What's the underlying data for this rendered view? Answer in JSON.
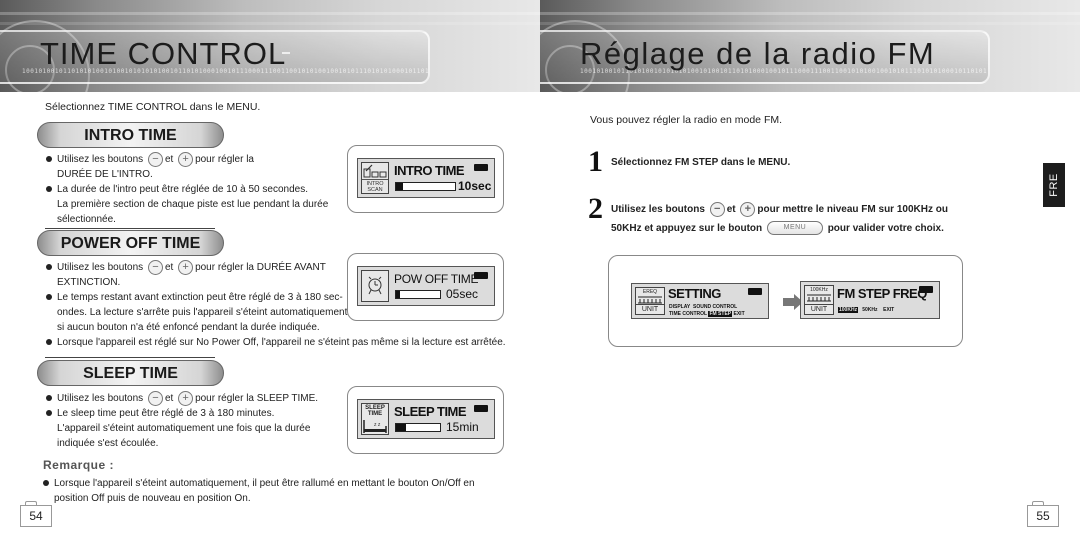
{
  "left_page": {
    "header_title": "TIME CONTROL",
    "binary_decoration": "100101001011010101001010010101010100101101010001001011100011100110010101001001010111010101000101101",
    "intro": "Sélectionnez TIME CONTROL dans le MENU.",
    "sections": [
      {
        "heading": "INTRO TIME",
        "bullets": [
          {
            "pre": "Utilisez les boutons",
            "mid": "et",
            "post": "pour régler la",
            "cont": "DURÉE DE L'INTRO."
          },
          {
            "text": "La durée de l'intro peut être réglée de 10 à 50 secondes.",
            "cont": "La première section de chaque piste est lue pendant la durée",
            "cont2": "sélectionnée."
          }
        ],
        "display": {
          "icon": "intro-scan-icon",
          "icon_label_1": "INTRO",
          "icon_label_2": "SCAN",
          "title": "INTRO TIME",
          "value": "10sec",
          "progress": 0.12
        }
      },
      {
        "heading": "POWER OFF TIME",
        "bullets": [
          {
            "pre": "Utilisez les boutons",
            "mid": "et",
            "post": "pour régler la DURÉE AVANT",
            "cont": "EXTINCTION."
          },
          {
            "text": "Le temps restant avant extinction peut être réglé de 3 à 180 sec-",
            "cont": "ondes. La lecture s'arrête puis l'appareil s'éteint automatiquement",
            "cont2": "si aucun bouton n'a été enfoncé pendant la durée indiquée."
          },
          {
            "text": "Lorsque l'appareil est réglé sur No Power Off, l'appareil ne s'éteint pas même si la lecture est arrêtée."
          }
        ],
        "display": {
          "icon": "alarm-clock-icon",
          "title": "POW OFF TIME",
          "value": "05sec",
          "progress": 0.1
        }
      },
      {
        "heading": "SLEEP TIME",
        "bullets": [
          {
            "pre": "Utilisez les boutons",
            "mid": "et",
            "post": "pour régler la SLEEP TIME."
          },
          {
            "text": "Le sleep time peut être réglé de 3 à 180 minutes.",
            "cont": "L'appareil s'éteint automatiquement une fois que la durée",
            "cont2": "indiquée s'est écoulée."
          }
        ],
        "display": {
          "icon": "sleep-time-icon",
          "icon_label_1": "SLEEP",
          "icon_label_2": "TIME",
          "title": "SLEEP TIME",
          "value": "15min",
          "progress": 0.22
        }
      }
    ],
    "remark_label": "Remarque :",
    "remark_text_1": "Lorsque l'appareil s'éteint automatiquement, il peut être rallumé en mettant le bouton On/Off en",
    "remark_text_2": "position Off puis de nouveau en position On.",
    "page_number": "54"
  },
  "right_page": {
    "header_title": "Réglage de la radio FM",
    "binary_decoration": "100101001011010100101010101001010010110101000100101110001110011001010100100101011101010100010110101",
    "intro": "Vous pouvez régler la radio en mode FM.",
    "steps": [
      {
        "number": "1",
        "text": "Sélectionnez FM STEP dans le MENU."
      },
      {
        "number": "2",
        "pre": "Utilisez les boutons",
        "mid": "et",
        "post": "pour mettre le niveau FM sur 100KHz ou",
        "line2_pre": "50KHz et appuyez sur le bouton",
        "menu_button": "MENU",
        "line2_post": "pour valider votre choix."
      }
    ],
    "display_setting": {
      "icon_top": "EREQ",
      "icon_bottom": "UNIT",
      "title": "SETTING",
      "row1": [
        "DISPLAY",
        "SOUND CONTROL"
      ],
      "row2": [
        "TIME CONTROL",
        "FM STEP",
        "EXIT"
      ],
      "selected": "FM STEP"
    },
    "display_fmstep": {
      "icon_top": "100KHz",
      "icon_bottom": "UNIT",
      "title": "FM STEP FREQ",
      "options": [
        "100KHz",
        "50KHz",
        "EXIT"
      ],
      "selected": "100KHz"
    },
    "language_tab": "FRE",
    "page_number": "55"
  },
  "symbols": {
    "minus": "−",
    "plus": "+"
  }
}
